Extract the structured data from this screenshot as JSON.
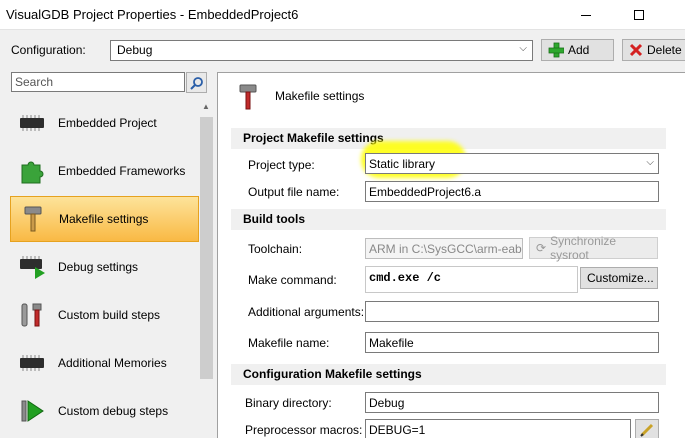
{
  "window": {
    "title": "VisualGDB Project Properties - EmbeddedProject6"
  },
  "config": {
    "label": "Configuration:",
    "value": "Debug",
    "add_label": "Add",
    "delete_label": "Delete"
  },
  "search": {
    "placeholder": "Search"
  },
  "nav": {
    "items": [
      {
        "label": "Embedded Project",
        "icon": "chip-icon"
      },
      {
        "label": "Embedded Frameworks",
        "icon": "puzzle-icon"
      },
      {
        "label": "Makefile settings",
        "icon": "hammer-icon",
        "selected": true
      },
      {
        "label": "Debug settings",
        "icon": "chip-play-icon"
      },
      {
        "label": "Custom build steps",
        "icon": "tools-icon"
      },
      {
        "label": "Additional Memories",
        "icon": "chip-icon"
      },
      {
        "label": "Custom debug steps",
        "icon": "play-icon"
      }
    ]
  },
  "panel": {
    "title": "Makefile settings",
    "sections": {
      "project_makefile": "Project Makefile settings",
      "build_tools": "Build tools",
      "config_makefile": "Configuration Makefile settings"
    },
    "project_type": {
      "label": "Project type:",
      "value": "Static library"
    },
    "output_file": {
      "label": "Output file name:",
      "value": "EmbeddedProject6.a"
    },
    "toolchain": {
      "label": "Toolchain:",
      "value": "ARM in C:\\SysGCC\\arm-eab",
      "sync_label": "Synchronize sysroot"
    },
    "make_command": {
      "label": "Make command:",
      "value": "cmd.exe /c",
      "customize_label": "Customize..."
    },
    "additional_args": {
      "label": "Additional arguments:",
      "value": ""
    },
    "makefile_name": {
      "label": "Makefile name:",
      "value": "Makefile"
    },
    "binary_dir": {
      "label": "Binary directory:",
      "value": "Debug"
    },
    "preprocessor": {
      "label": "Preprocessor macros:",
      "value": "DEBUG=1"
    }
  },
  "colors": {
    "highlight": "#ffff00",
    "selected_nav": "#f9b944",
    "add_green": "#2ea82e",
    "delete_red": "#d42020"
  }
}
